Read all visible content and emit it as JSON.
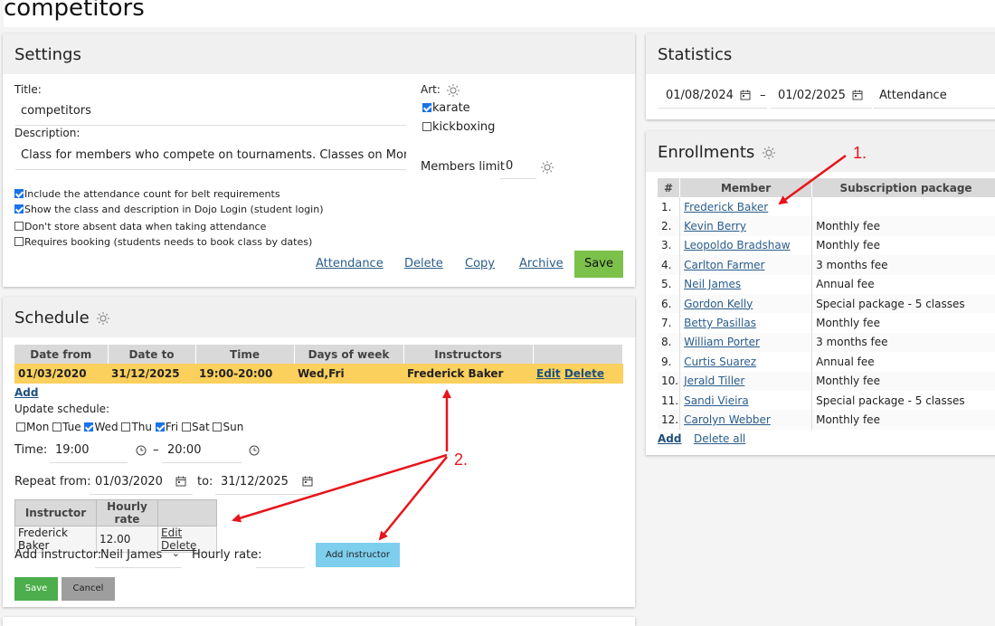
{
  "page": {
    "title": "competitors"
  },
  "settings": {
    "heading": "Settings",
    "title_label": "Title:",
    "title_value": "competitors",
    "description_label": "Description:",
    "description_value": "Class for members who compete on tournaments. Classes on Monday",
    "art_label": "Art:",
    "arts": [
      {
        "label": "karate",
        "checked": true
      },
      {
        "label": "kickboxing",
        "checked": false
      }
    ],
    "members_limit_label": "Members limit",
    "members_limit_value": "0",
    "options": [
      {
        "label": "Include the attendance count for belt requirements",
        "checked": true
      },
      {
        "label": "Show the class and description in Dojo Login (student login)",
        "checked": true
      },
      {
        "label": "Don't store absent data when taking attendance",
        "checked": false
      },
      {
        "label": "Requires booking (students needs to book class by dates)",
        "checked": false
      }
    ],
    "links": {
      "attendance": "Attendance",
      "delete": "Delete",
      "copy": "Copy",
      "archive": "Archive"
    },
    "save_label": "Save"
  },
  "schedule": {
    "heading": "Schedule",
    "columns": [
      "Date from",
      "Date to",
      "Time",
      "Days of week",
      "Instructors",
      ""
    ],
    "row": {
      "date_from": "01/03/2020",
      "date_to": "31/12/2025",
      "time": "19:00-20:00",
      "days": "Wed,Fri",
      "instructors": "Frederick Baker",
      "edit": "Edit",
      "delete": "Delete"
    },
    "add_label": "Add",
    "update_label": "Update schedule:",
    "days": [
      {
        "label": "Mon",
        "checked": false
      },
      {
        "label": "Tue",
        "checked": false
      },
      {
        "label": "Wed",
        "checked": true
      },
      {
        "label": "Thu",
        "checked": false
      },
      {
        "label": "Fri",
        "checked": true
      },
      {
        "label": "Sat",
        "checked": false
      },
      {
        "label": "Sun",
        "checked": false
      }
    ],
    "time_label": "Time:",
    "time_from": "19:00",
    "time_to": "20:00",
    "dash": "–",
    "repeat_label": "Repeat from:",
    "repeat_from": "01/03/2020",
    "to_label": "to:",
    "repeat_to": "31/12/2025",
    "inst_columns": [
      "Instructor",
      "Hourly rate",
      ""
    ],
    "inst_row": {
      "name": "Frederick Baker",
      "rate": "12.00",
      "edit": "Edit",
      "delete": "Delete"
    },
    "add_instructor_label": "Add instructor:",
    "add_instructor_value": "Neil James",
    "hourly_rate_label": "Hourly rate:",
    "add_instructor_button": "Add instructor",
    "save_label": "Save",
    "cancel_label": "Cancel"
  },
  "statistics": {
    "heading": "Statistics",
    "date_from": "01/08/2024",
    "date_to": "01/02/2025",
    "dash": "–",
    "type": "Attendance"
  },
  "enrollments": {
    "heading": "Enrollments",
    "columns": [
      "#",
      "Member",
      "Subscription package"
    ],
    "rows": [
      {
        "n": "1.",
        "member": "Frederick Baker",
        "package": ""
      },
      {
        "n": "2.",
        "member": "Kevin Berry",
        "package": "Monthly fee"
      },
      {
        "n": "3.",
        "member": "Leopoldo Bradshaw",
        "package": "Monthly fee"
      },
      {
        "n": "4.",
        "member": "Carlton Farmer",
        "package": "3 months fee"
      },
      {
        "n": "5.",
        "member": "Neil James",
        "package": "Annual fee"
      },
      {
        "n": "6.",
        "member": "Gordon Kelly",
        "package": "Special package - 5 classes"
      },
      {
        "n": "7.",
        "member": "Betty Pasillas",
        "package": "Monthly fee"
      },
      {
        "n": "8.",
        "member": "William Porter",
        "package": "3 months fee"
      },
      {
        "n": "9.",
        "member": "Curtis Suarez",
        "package": "Annual fee"
      },
      {
        "n": "10.",
        "member": "Jerald Tiller",
        "package": "Monthly fee"
      },
      {
        "n": "11.",
        "member": "Sandi Vieira",
        "package": "Special package - 5 classes"
      },
      {
        "n": "12.",
        "member": "Carolyn Webber",
        "package": "Monthly fee"
      }
    ],
    "add_label": "Add",
    "delete_all_label": "Delete all"
  },
  "annotations": {
    "one": "1.",
    "two": "2."
  },
  "colors": {
    "highlight": "#fbd05d",
    "save": "#7cc14a",
    "add_instructor": "#7ecfee",
    "arrow": "#e8141b",
    "link": "#2a5d8c"
  }
}
